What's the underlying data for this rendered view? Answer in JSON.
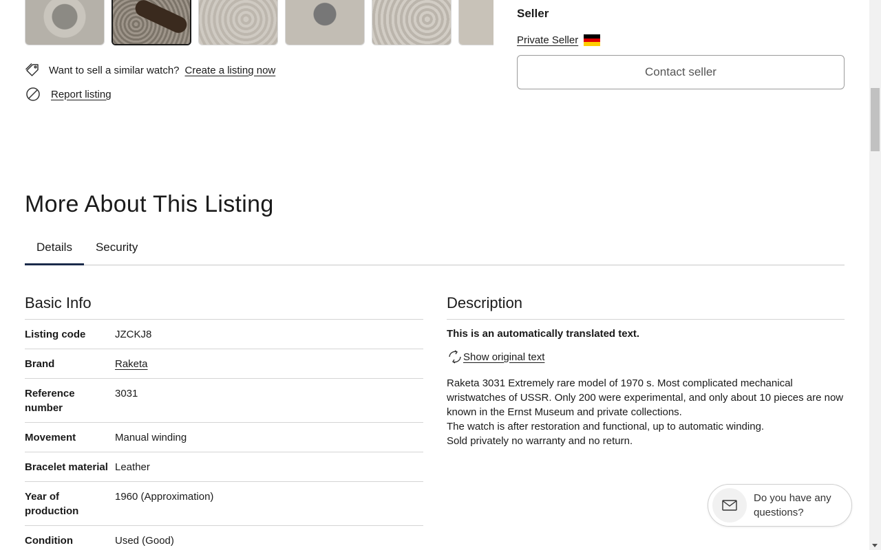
{
  "gallery": {
    "thumbnails": [
      {
        "alt": "watch-photo-1"
      },
      {
        "alt": "watch-photo-2"
      },
      {
        "alt": "watch-photo-3"
      },
      {
        "alt": "watch-photo-4"
      },
      {
        "alt": "watch-photo-5"
      },
      {
        "alt": "watch-photo-6"
      }
    ]
  },
  "sell_prompt": {
    "text": "Want to sell a similar watch?",
    "link": "Create a listing now"
  },
  "report": {
    "link": "Report listing"
  },
  "seller": {
    "title": "Seller",
    "name": "Private Seller",
    "flag_colors": [
      "#000000",
      "#dd0000",
      "#ffce00"
    ],
    "contact_button": "Contact seller"
  },
  "more_about": {
    "title": "More About This Listing",
    "tabs": [
      {
        "label": "Details"
      },
      {
        "label": "Security"
      }
    ]
  },
  "basic_info": {
    "title": "Basic Info",
    "rows": [
      {
        "key": "Listing code",
        "value": "JZCKJ8"
      },
      {
        "key": "Brand",
        "value": "Raketa"
      },
      {
        "key": "Reference number",
        "value": "3031"
      },
      {
        "key": "Movement",
        "value": "Manual winding"
      },
      {
        "key": "Bracelet material",
        "value": "Leather"
      },
      {
        "key": "Year of production",
        "value": "1960 (Approximation)"
      },
      {
        "key": "Condition",
        "value": "Used (Good)"
      }
    ]
  },
  "description": {
    "title": "Description",
    "note": "This is an automatically translated text.",
    "show_original": " Show original text",
    "lines": [
      "Raketa 3031 Extremely rare model of 1970 s. Most complicated mechanical wristwatches of USSR. Only 200 were experimental, and only about 10 pieces are now known in the Ernst Museum and private collections.",
      "The watch is after restoration and functional, up to automatic winding.",
      "Sold privately no warranty and no return."
    ]
  },
  "chat": {
    "text": "Do you have any questions?"
  }
}
